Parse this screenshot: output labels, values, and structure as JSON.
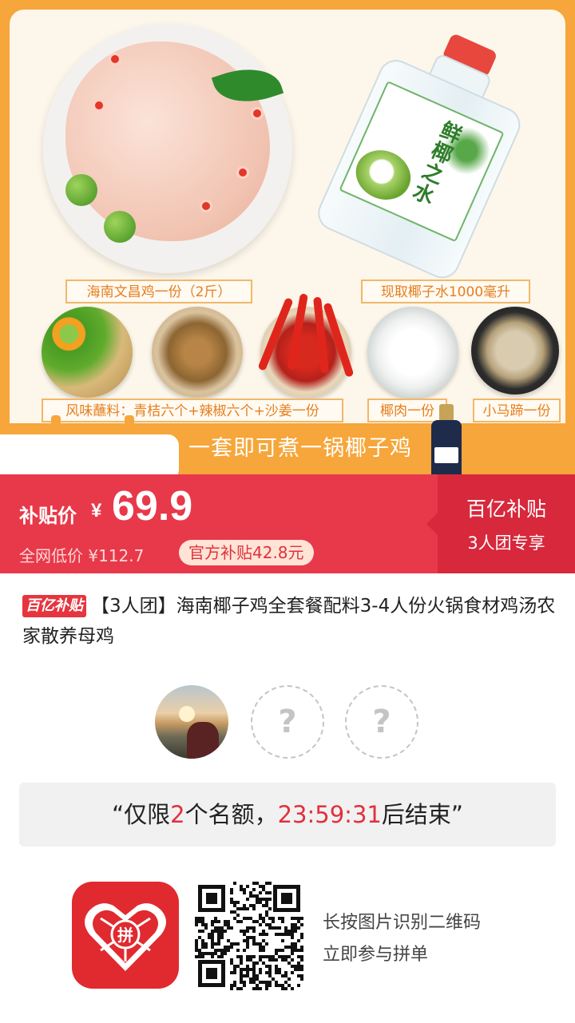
{
  "hero": {
    "bottle_brand": "鲜椰之水",
    "captions": {
      "chicken": "海南文昌鸡一份（2斤）",
      "coconut_water": "现取椰子水1000毫升",
      "sauce": "风味蘸料：青桔六个+辣椒六个+沙姜一份",
      "coconut_meat": "椰肉一份",
      "water_chestnut": "小马蹄一份"
    },
    "slogan": "一套即可煮一锅椰子鸡"
  },
  "price": {
    "label": "补贴价",
    "currency": "¥",
    "value": "69.9",
    "original": "全网低价 ¥112.7",
    "subsidy": "官方补贴42.8元",
    "promo_title": "百亿补贴",
    "promo_sub": "3人团专享"
  },
  "product": {
    "badge": "百亿补贴",
    "title": "【3人团】海南椰子鸡全套餐配料3-4人份火锅食材鸡汤农家散养母鸡"
  },
  "group": {
    "empty_slot_symbol": "?"
  },
  "countdown": {
    "prefix": "“仅限",
    "slots": "2",
    "middle": "个名额，",
    "time": "23:59:31",
    "suffix": "后结束”"
  },
  "footer": {
    "line1": "长按图片识别二维码",
    "line2": "立即参与拼单",
    "app_logo_char": "拼"
  },
  "colors": {
    "price_red": "#e7394a",
    "promo_red": "#d7283c",
    "hero_orange": "#f6a63a",
    "highlight_red": "#e0313c"
  }
}
